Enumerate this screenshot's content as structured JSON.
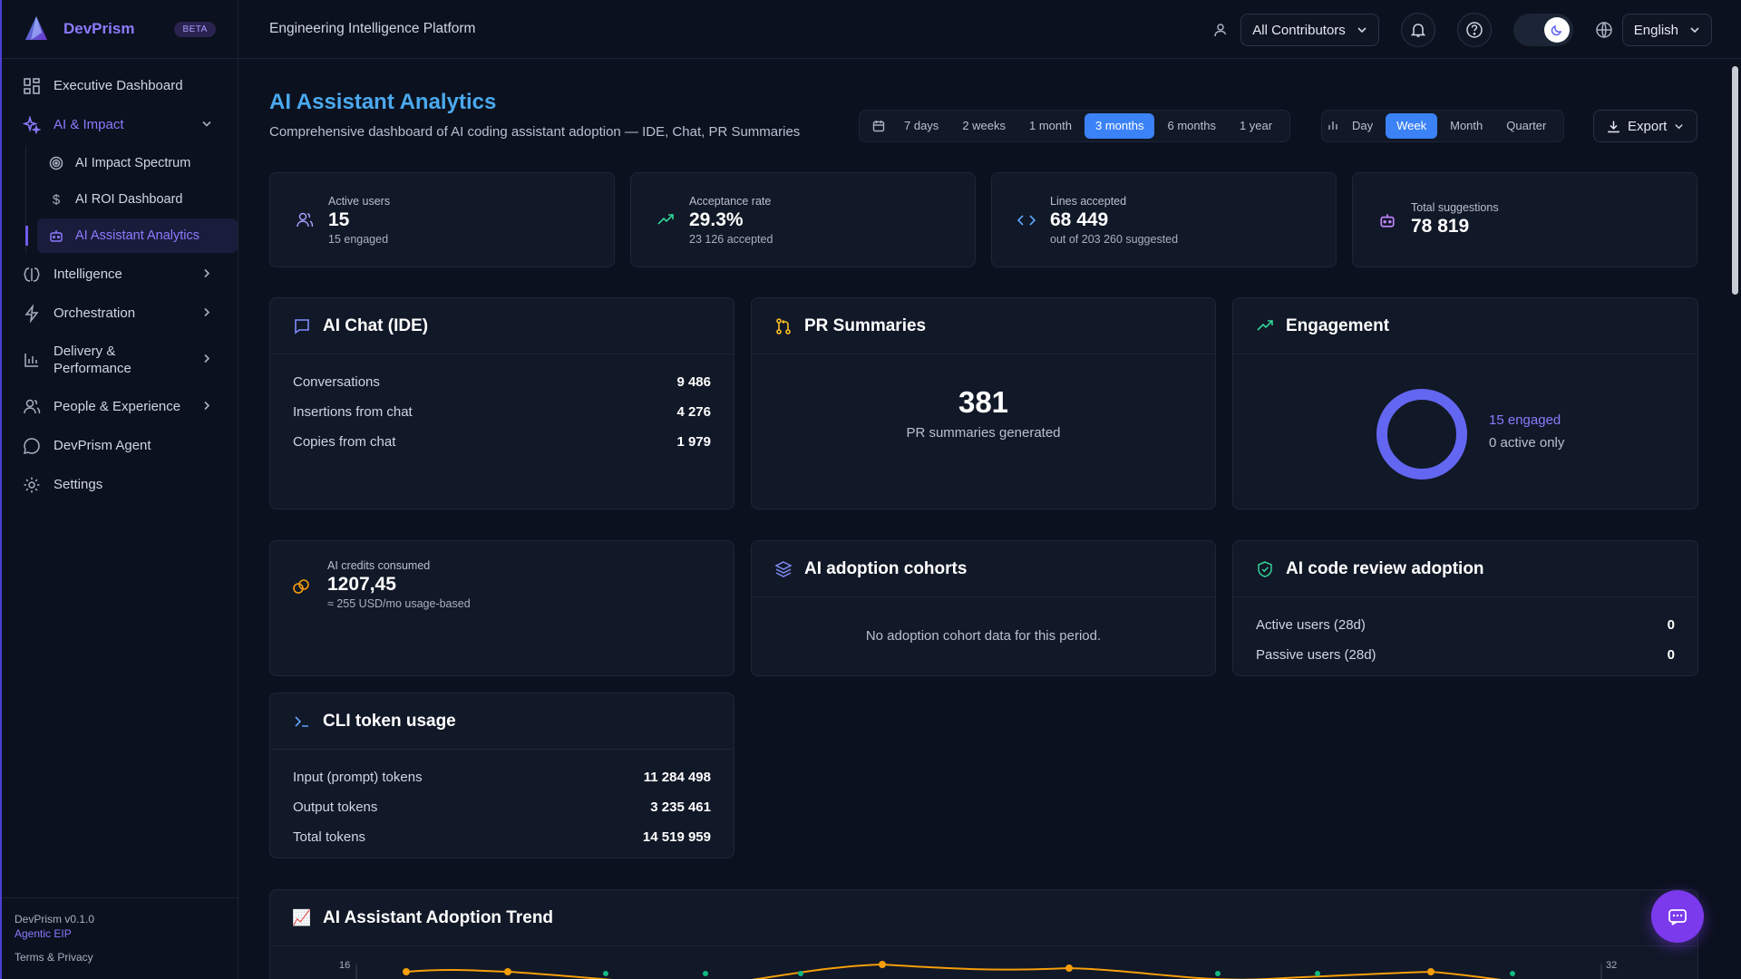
{
  "brand": {
    "name": "DevPrism",
    "badge": "BETA"
  },
  "topbar": {
    "title": "Engineering Intelligence Platform",
    "contributors": "All Contributors",
    "language": "English"
  },
  "sidebar": {
    "items": [
      {
        "label": "Executive Dashboard",
        "icon": "grid-icon"
      },
      {
        "label": "AI & Impact",
        "icon": "sparkles-icon"
      },
      {
        "label": "Intelligence",
        "icon": "brain-icon"
      },
      {
        "label": "Orchestration",
        "icon": "bolt-icon"
      },
      {
        "label": "Delivery &",
        "label2": "Performance",
        "icon": "bar-chart-icon"
      },
      {
        "label": "People & Experience",
        "icon": "users-icon"
      },
      {
        "label": "DevPrism Agent",
        "icon": "chat-icon"
      },
      {
        "label": "Settings",
        "icon": "gear-icon"
      }
    ],
    "sub_items": [
      {
        "label": "AI Impact Spectrum",
        "icon": "target-icon"
      },
      {
        "label": "AI ROI Dashboard",
        "icon": "dollar-icon"
      },
      {
        "label": "AI Assistant Analytics",
        "icon": "robot-icon"
      }
    ],
    "footer": {
      "version": "DevPrism v0.1.0",
      "edition": "Agentic EIP",
      "terms": "Terms & Privacy"
    }
  },
  "page": {
    "title": "AI Assistant Analytics",
    "subtitle": "Comprehensive dashboard of AI coding assistant adoption — IDE, Chat, PR Summaries",
    "ranges": [
      "7 days",
      "2 weeks",
      "1 month",
      "3 months",
      "6 months",
      "1 year"
    ],
    "active_range": "3 months",
    "granularity": [
      "Day",
      "Week",
      "Month",
      "Quarter"
    ],
    "active_granularity": "Week",
    "export": "Export"
  },
  "kpis": [
    {
      "label": "Active users",
      "value": "15",
      "sub": "15 engaged"
    },
    {
      "label": "Acceptance rate",
      "value": "29.3%",
      "sub": "23 126 accepted"
    },
    {
      "label": "Lines accepted",
      "value": "68 449",
      "sub": "out of 203 260 suggested"
    },
    {
      "label": "Total suggestions",
      "value": "78 819",
      "sub": ""
    }
  ],
  "ai_chat": {
    "title": "AI Chat (IDE)",
    "rows": [
      {
        "label": "Conversations",
        "value": "9 486"
      },
      {
        "label": "Insertions from chat",
        "value": "4 276"
      },
      {
        "label": "Copies from chat",
        "value": "1 979"
      }
    ]
  },
  "pr_summaries": {
    "title": "PR Summaries",
    "value": "381",
    "label": "PR summaries generated"
  },
  "engagement": {
    "title": "Engagement",
    "engaged": "15 engaged",
    "active_only": "0 active only",
    "engaged_fraction": 1.0
  },
  "credits": {
    "label": "AI credits consumed",
    "value": "1207,45",
    "sub": "≈ 255 USD/mo usage-based"
  },
  "cohorts": {
    "title": "AI adoption cohorts",
    "empty": "No adoption cohort data for this period."
  },
  "code_review": {
    "title": "AI code review adoption",
    "rows": [
      {
        "label": "Active users (28d)",
        "value": "0"
      },
      {
        "label": "Passive users (28d)",
        "value": "0"
      }
    ]
  },
  "cli": {
    "title": "CLI token usage",
    "rows": [
      {
        "label": "Input (prompt) tokens",
        "value": "11 284 498"
      },
      {
        "label": "Output tokens",
        "value": "3 235 461"
      },
      {
        "label": "Total tokens",
        "value": "14 519 959"
      }
    ]
  },
  "trend": {
    "title": "AI Assistant Adoption Trend",
    "icon": "📈",
    "y_left_top": "16",
    "y_right_top": "32"
  },
  "colors": {
    "accent": "#8b7bff",
    "blue": "#3b82f6",
    "title_blue": "#4ba9ee",
    "ring": "#6366f1",
    "line_orange": "#f59e0b",
    "line_green": "#10b981"
  }
}
